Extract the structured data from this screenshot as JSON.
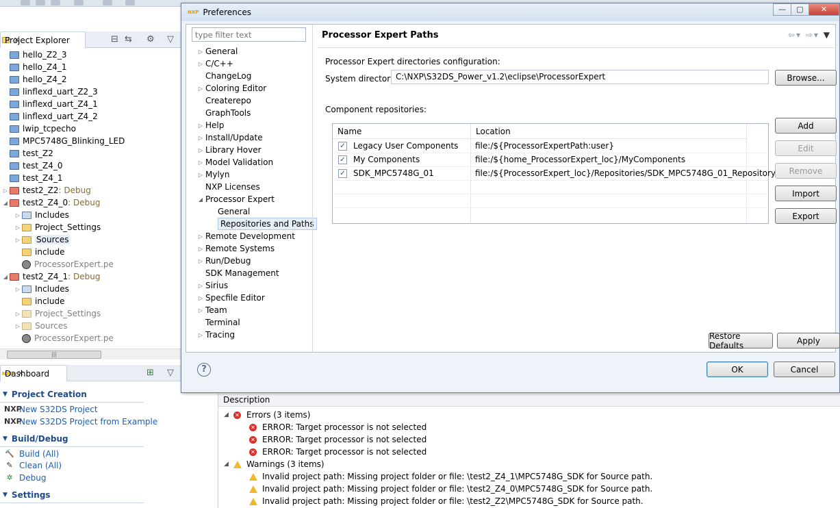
{
  "project_explorer": {
    "tab_label": "Project Explorer",
    "items": [
      {
        "label": "hello_Z2_3",
        "icon": "folder-icon"
      },
      {
        "label": "hello_Z4_1",
        "icon": "folder-icon"
      },
      {
        "label": "hello_Z4_2",
        "icon": "folder-icon"
      },
      {
        "label": "linflexd_uart_Z2_3",
        "icon": "folder-icon"
      },
      {
        "label": "linflexd_uart_Z4_1",
        "icon": "folder-icon"
      },
      {
        "label": "linflexd_uart_Z4_2",
        "icon": "folder-icon"
      },
      {
        "label": "lwip_tcpecho",
        "icon": "folder-icon"
      },
      {
        "label": "MPC5748G_Blinking_LED",
        "icon": "folder-icon"
      },
      {
        "label": "test_Z2",
        "icon": "folder-icon"
      },
      {
        "label": "test_Z4_0",
        "icon": "folder-icon"
      },
      {
        "label": "test_Z4_1",
        "icon": "folder-icon"
      },
      {
        "label": "test2_Z2",
        "tag": ": Debug"
      },
      {
        "label": "test2_Z4_0",
        "tag": ": Debug"
      },
      {
        "label": "Includes"
      },
      {
        "label": "Project_Settings"
      },
      {
        "label": "Sources"
      },
      {
        "label": "include"
      },
      {
        "label": "ProcessorExpert.pe"
      },
      {
        "label": "test2_Z4_1",
        "tag": ": Debug"
      },
      {
        "label": "Includes"
      },
      {
        "label": "include"
      },
      {
        "label": "Project_Settings"
      },
      {
        "label": "Sources"
      },
      {
        "label": "ProcessorExpert.pe"
      }
    ]
  },
  "dashboard": {
    "tab_label": "Dashboard",
    "sections": [
      {
        "title": "Project Creation",
        "links": [
          "New S32DS Project",
          "New S32DS Project from Example"
        ]
      },
      {
        "title": "Build/Debug",
        "links": [
          "Build   (All)",
          "Clean   (All)",
          "Debug"
        ]
      },
      {
        "title": "Settings",
        "links": []
      }
    ]
  },
  "problems": {
    "column": "Description",
    "errors_group": "Errors (3 items)",
    "errors": [
      "ERROR: Target processor is not selected",
      "ERROR: Target processor is not selected",
      "ERROR: Target processor is not selected"
    ],
    "warnings_group": "Warnings (3 items)",
    "warnings": [
      "Invalid project path: Missing project folder or file: \\test2_Z4_1\\MPC5748G_SDK for Source path.",
      "Invalid project path: Missing project folder or file: \\test2_Z4_0\\MPC5748G_SDK for Source path.",
      "Invalid project path: Missing project folder or file: \\test2_Z2\\MPC5748G_SDK for Source path."
    ]
  },
  "dialog": {
    "title": "Preferences",
    "filter_placeholder": "type filter text",
    "nav": [
      {
        "label": "General",
        "arrow": "▷",
        "level": 0
      },
      {
        "label": "C/C++",
        "arrow": "▷",
        "level": 0
      },
      {
        "label": "ChangeLog",
        "arrow": "",
        "level": 0
      },
      {
        "label": "Coloring Editor",
        "arrow": "▷",
        "level": 0
      },
      {
        "label": "Createrepo",
        "arrow": "",
        "level": 0
      },
      {
        "label": "GraphTools",
        "arrow": "",
        "level": 0
      },
      {
        "label": "Help",
        "arrow": "▷",
        "level": 0
      },
      {
        "label": "Install/Update",
        "arrow": "▷",
        "level": 0
      },
      {
        "label": "Library Hover",
        "arrow": "▷",
        "level": 0
      },
      {
        "label": "Model Validation",
        "arrow": "▷",
        "level": 0
      },
      {
        "label": "Mylyn",
        "arrow": "▷",
        "level": 0
      },
      {
        "label": "NXP Licenses",
        "arrow": "",
        "level": 0
      },
      {
        "label": "Processor Expert",
        "arrow": "◢",
        "level": 0
      },
      {
        "label": "General",
        "arrow": "",
        "level": 1
      },
      {
        "label": "Repositories and Paths",
        "arrow": "",
        "level": 1,
        "selected": true
      },
      {
        "label": "Remote Development",
        "arrow": "▷",
        "level": 0
      },
      {
        "label": "Remote Systems",
        "arrow": "▷",
        "level": 0
      },
      {
        "label": "Run/Debug",
        "arrow": "▷",
        "level": 0
      },
      {
        "label": "SDK Management",
        "arrow": "",
        "level": 0
      },
      {
        "label": "Sirius",
        "arrow": "▷",
        "level": 0
      },
      {
        "label": "Specfile Editor",
        "arrow": "▷",
        "level": 0
      },
      {
        "label": "Team",
        "arrow": "▷",
        "level": 0
      },
      {
        "label": "Terminal",
        "arrow": "",
        "level": 0
      },
      {
        "label": "Tracing",
        "arrow": "▷",
        "level": 0
      }
    ],
    "page_title": "Processor Expert Paths",
    "dir_config_label": "Processor Expert directories configuration:",
    "system_dir_label": "System directory",
    "system_dir_value": "C:\\NXP\\S32DS_Power_v1.2\\eclipse\\ProcessorExpert",
    "browse_button": "Browse...",
    "repos_label": "Component repositories:",
    "table": {
      "col_name": "Name",
      "col_location": "Location",
      "rows": [
        {
          "name": "Legacy User Components",
          "location": "file:/${ProcessorExpertPath:user}",
          "checked": true
        },
        {
          "name": "My Components",
          "location": "file:/${home_ProcessorExpert_loc}/MyComponents",
          "checked": true
        },
        {
          "name": "SDK_MPC5748G_01",
          "location": "file:/${ProcessorExpert_loc}/Repositories/SDK_MPC5748G_01_Repository",
          "checked": true
        }
      ]
    },
    "buttons": {
      "add": "Add",
      "edit": "Edit",
      "remove": "Remove",
      "import": "Import",
      "export": "Export",
      "restore_defaults": "Restore Defaults",
      "apply": "Apply",
      "ok": "OK",
      "cancel": "Cancel"
    },
    "help_symbol": "?"
  },
  "colors": {
    "accent": "#1a5fb4",
    "error": "#d9302a",
    "warning": "#f1b82d",
    "selection": "#e6eef8"
  }
}
